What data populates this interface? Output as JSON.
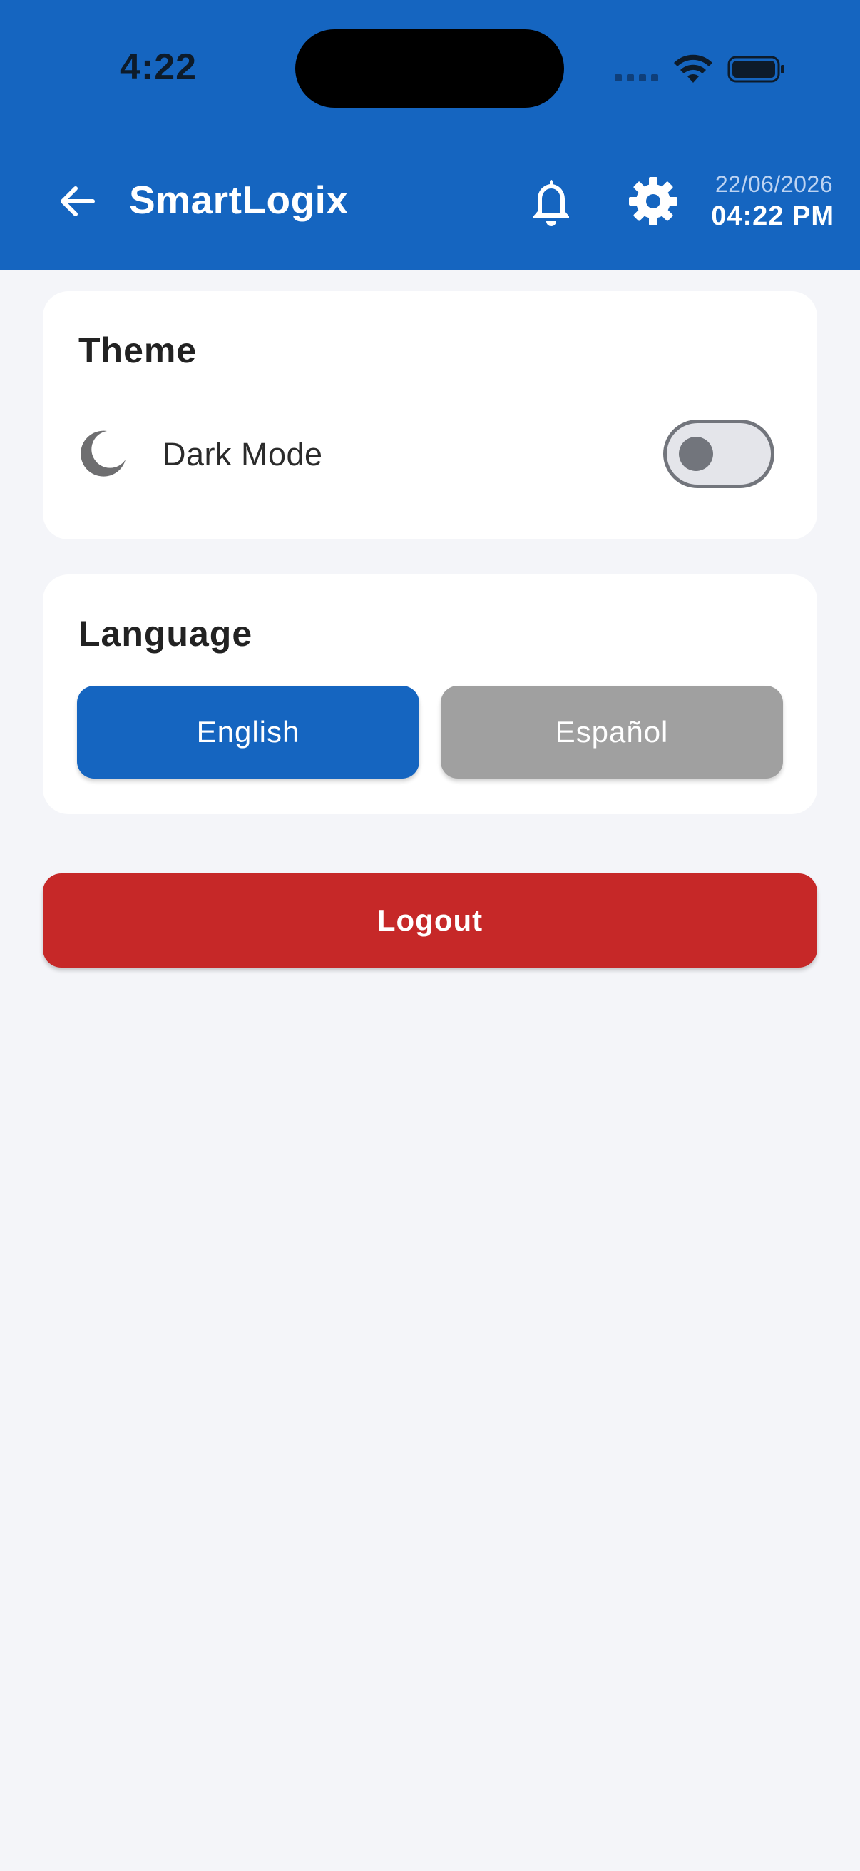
{
  "status_bar": {
    "time": "4:22"
  },
  "app_bar": {
    "title": "SmartLogix",
    "date": "22/06/2026",
    "time": "04:22 PM",
    "icons": [
      "back-arrow-icon",
      "bell-icon",
      "gear-icon"
    ]
  },
  "theme_section": {
    "title": "Theme",
    "dark_mode_label": "Dark Mode",
    "dark_mode_enabled": false,
    "icon": "moon-icon"
  },
  "language_section": {
    "title": "Language",
    "options": [
      "English",
      "Español"
    ],
    "selected": "English"
  },
  "logout": {
    "label": "Logout"
  },
  "colors": {
    "primary": "#1565c0",
    "danger": "#c62828",
    "inactive": "#a0a0a0",
    "background": "#f4f5f9",
    "card": "#ffffff"
  }
}
